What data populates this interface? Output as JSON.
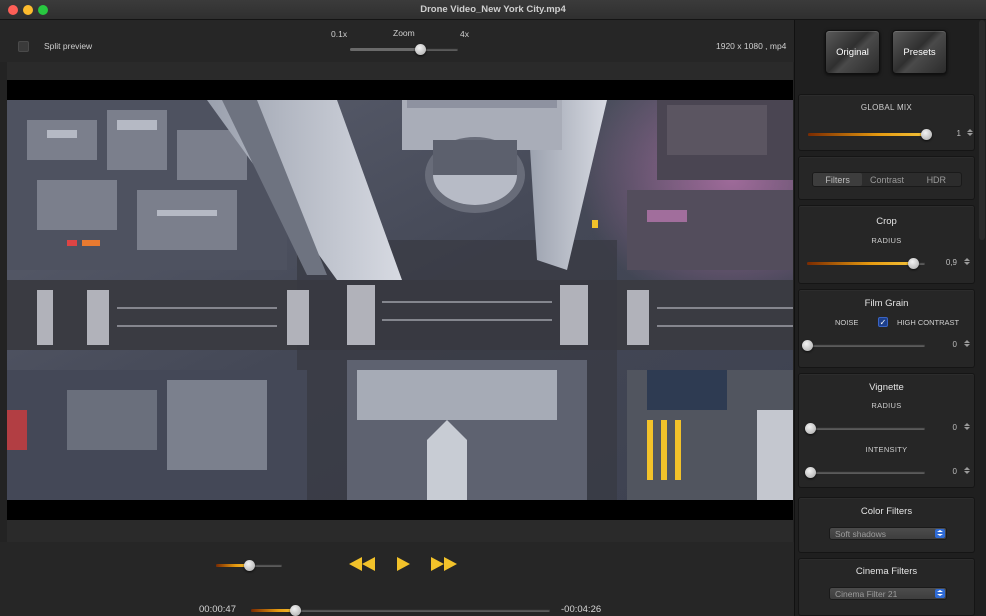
{
  "window": {
    "title": "Drone Video_New York City.mp4"
  },
  "topbar": {
    "split_preview_label": "Split preview",
    "zoom_min_label": "0.1x",
    "zoom_label": "Zoom",
    "zoom_max_label": "4x",
    "zoom_value": 0.65,
    "video_info": "1920 x 1080 , mp4"
  },
  "playback": {
    "volume_value": 0.5,
    "current_time": "00:00:47",
    "remaining_time": "-00:04:26",
    "progress_value": 0.15,
    "accent_color": "#f2c22a"
  },
  "sidebar": {
    "original_label": "Original",
    "presets_label": "Presets",
    "global_mix": {
      "title": "GLOBAL MIX",
      "value": "1",
      "level": 1.0
    },
    "tabs": [
      "Filters",
      "Contrast",
      "HDR"
    ],
    "active_tab": "Filters",
    "crop": {
      "title": "Crop",
      "radius_label": "RADIUS",
      "value": "0,9",
      "level": 0.9
    },
    "film_grain": {
      "title": "Film Grain",
      "noise_label": "NOISE",
      "high_contrast_label": "HIGH CONTRAST",
      "high_contrast_checked": true,
      "value": "0",
      "level": 0
    },
    "vignette": {
      "title": "Vignette",
      "radius_label": "RADIUS",
      "radius_value": "0",
      "intensity_label": "INTENSITY",
      "intensity_value": "0"
    },
    "color_filters": {
      "title": "Color Filters",
      "selected": "Soft shadows"
    },
    "cinema_filters": {
      "title": "Cinema Filters",
      "selected": "Cinema Filter 21"
    }
  }
}
